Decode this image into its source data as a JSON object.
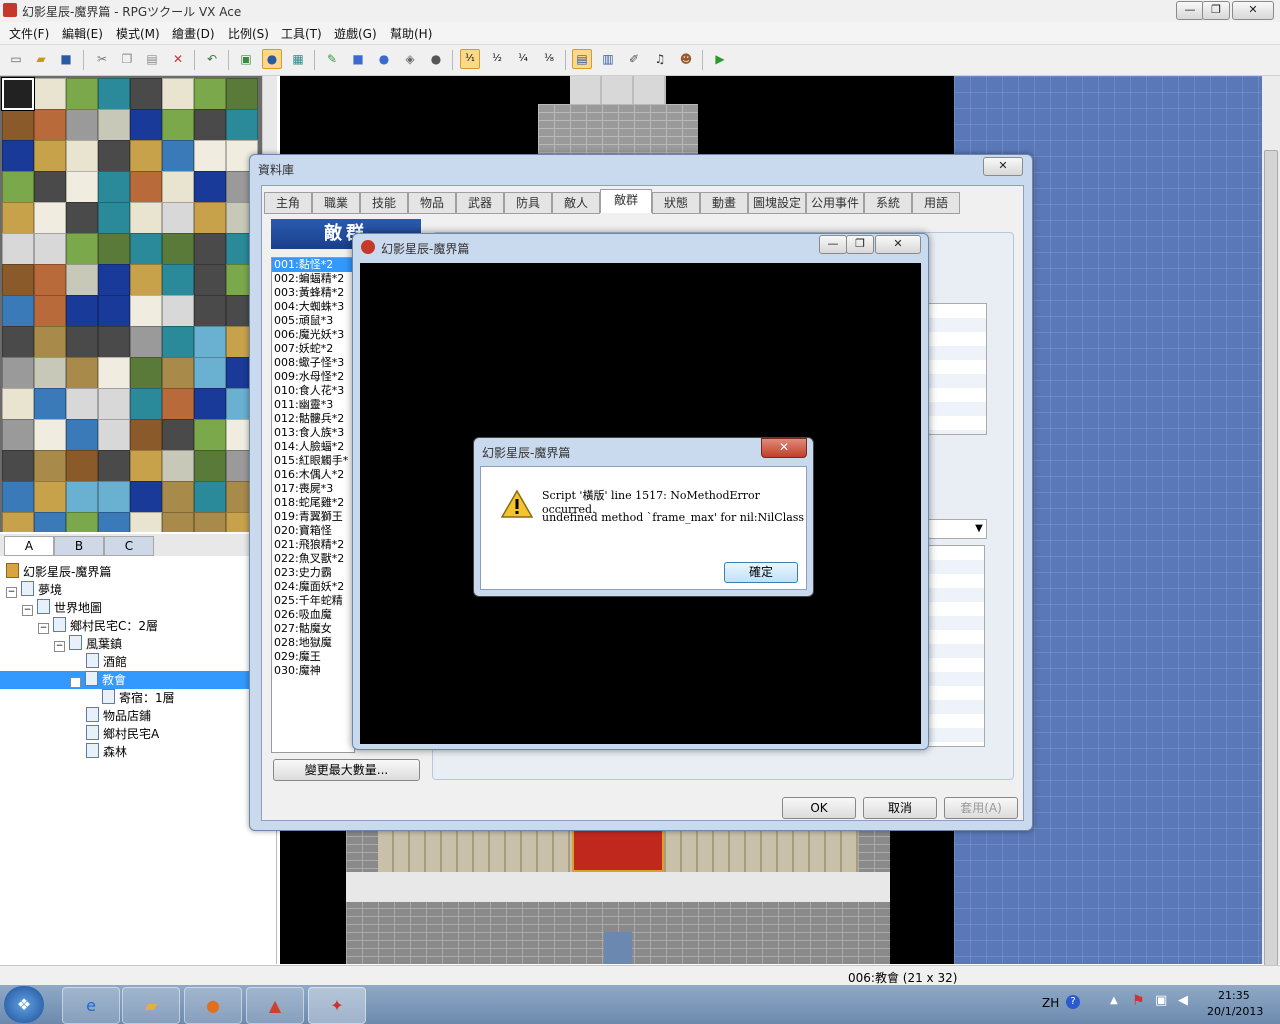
{
  "window": {
    "title": "幻影星辰-魔界篇 - RPGツクール VX Ace",
    "minimize": "—",
    "maximize": "❐",
    "close": "✕"
  },
  "menubar": [
    "文件(F)",
    "編輯(E)",
    "模式(M)",
    "繪畫(D)",
    "比例(S)",
    "工具(T)",
    "遊戲(G)",
    "幫助(H)"
  ],
  "toolbar": {
    "icons": [
      "new-project-icon",
      "open-project-icon",
      "save-project-icon",
      "cut-icon",
      "copy-icon",
      "paste-icon",
      "delete-icon",
      "undo-icon",
      "map-mode-icon",
      "event-mode-icon",
      "region-mode-icon",
      "pencil-icon",
      "rectangle-icon",
      "ellipse-icon",
      "fill-icon",
      "shadow-pen-icon",
      "zoom-1-1-icon",
      "zoom-1-2-icon",
      "zoom-1-4-icon",
      "zoom-1-8-icon",
      "database-icon",
      "resource-manager-icon",
      "script-editor-icon",
      "sound-test-icon",
      "character-generator-icon",
      "playtest-icon"
    ],
    "labels": {
      "zoom_1_1": "¹⁄₁",
      "zoom_1_2": "¹⁄₂",
      "zoom_1_4": "¹⁄₄",
      "zoom_1_8": "¹⁄₈"
    }
  },
  "tileset_tabs": [
    "A",
    "B",
    "C"
  ],
  "tree": {
    "root": "幻影星辰-魔界篇",
    "nodes": [
      "夢境",
      "世界地圖",
      "鄉村民宅C：2層",
      "風葉鎮",
      "酒館",
      "教會",
      "寄宿：1層",
      "物品店鋪",
      "鄉村民宅A",
      "森林"
    ]
  },
  "statusbar": {
    "map": "006:教會 (21 x 32)"
  },
  "database": {
    "title": "資料庫",
    "tabs": [
      "主角",
      "職業",
      "技能",
      "物品",
      "武器",
      "防具",
      "敵人",
      "敵群",
      "狀態",
      "動畫",
      "圖塊設定",
      "公用事件",
      "系統",
      "用語"
    ],
    "active_tab": "敵群",
    "list_header": "敵群",
    "list": [
      "001:黏怪*2",
      "002:蝙蝠精*2",
      "003:黃蜂精*2",
      "004:大蜘蛛*3",
      "005:頑鼠*3",
      "006:魔光妖*3",
      "007:妖蛇*2",
      "008:蠍子怪*3",
      "009:水母怪*2",
      "010:食人花*3",
      "011:幽靈*3",
      "012:骷髏兵*2",
      "013:食人族*3",
      "014:人臉蝠*2",
      "015:紅眼觸手*",
      "016:木偶人*2",
      "017:喪屍*3",
      "018:蛇尾雞*2",
      "019:青翼獅王",
      "020:寶箱怪",
      "021:飛狼精*2",
      "022:魚叉獸*2",
      "023:史力霸",
      "024:魔面妖*2",
      "025:千年蛇精",
      "026:吸血魔",
      "027:骷魔女",
      "028:地獄魔",
      "029:魔王",
      "030:魔神"
    ],
    "change_max": "變更最大數量...",
    "ok": "OK",
    "cancel": "取消",
    "apply": "套用(A)"
  },
  "game_window": {
    "title": "幻影星辰-魔界篇"
  },
  "error_dialog": {
    "title": "幻影星辰-魔界篇",
    "line1": "Script '橫版' line 1517: NoMethodError occurred.",
    "line2": "undefined method `frame_max' for nil:NilClass",
    "ok": "確定",
    "close": "✕"
  },
  "taskbar": {
    "lang": "ZH",
    "time": "21:35",
    "date": "20/1/2013"
  },
  "colors": {
    "accent": "#3399ff",
    "map_blue": "#5a78b8",
    "taskbar": "#7f9abb"
  }
}
